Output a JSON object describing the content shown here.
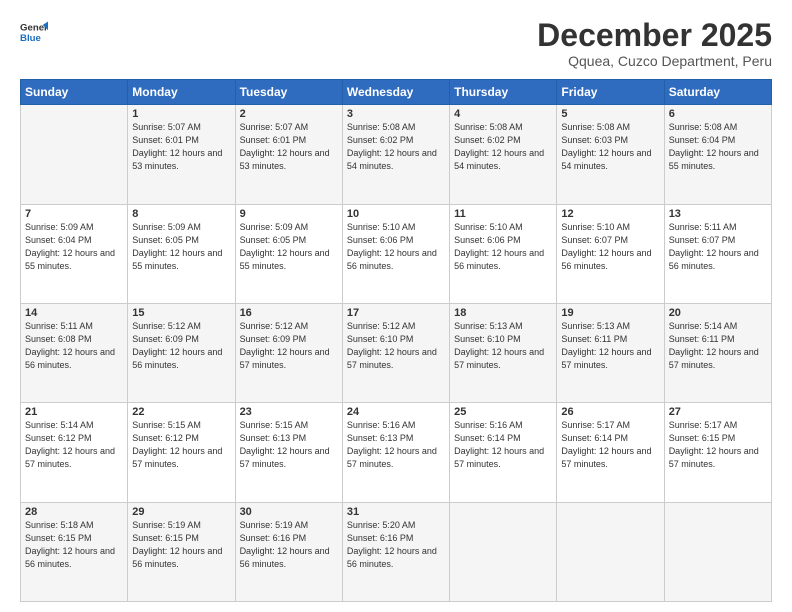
{
  "header": {
    "logo_line1": "General",
    "logo_line2": "Blue",
    "month": "December 2025",
    "location": "Qquea, Cuzco Department, Peru"
  },
  "weekdays": [
    "Sunday",
    "Monday",
    "Tuesday",
    "Wednesday",
    "Thursday",
    "Friday",
    "Saturday"
  ],
  "rows": [
    [
      {
        "day": "",
        "sunrise": "",
        "sunset": "",
        "daylight": ""
      },
      {
        "day": "1",
        "sunrise": "Sunrise: 5:07 AM",
        "sunset": "Sunset: 6:01 PM",
        "daylight": "Daylight: 12 hours and 53 minutes."
      },
      {
        "day": "2",
        "sunrise": "Sunrise: 5:07 AM",
        "sunset": "Sunset: 6:01 PM",
        "daylight": "Daylight: 12 hours and 53 minutes."
      },
      {
        "day": "3",
        "sunrise": "Sunrise: 5:08 AM",
        "sunset": "Sunset: 6:02 PM",
        "daylight": "Daylight: 12 hours and 54 minutes."
      },
      {
        "day": "4",
        "sunrise": "Sunrise: 5:08 AM",
        "sunset": "Sunset: 6:02 PM",
        "daylight": "Daylight: 12 hours and 54 minutes."
      },
      {
        "day": "5",
        "sunrise": "Sunrise: 5:08 AM",
        "sunset": "Sunset: 6:03 PM",
        "daylight": "Daylight: 12 hours and 54 minutes."
      },
      {
        "day": "6",
        "sunrise": "Sunrise: 5:08 AM",
        "sunset": "Sunset: 6:04 PM",
        "daylight": "Daylight: 12 hours and 55 minutes."
      }
    ],
    [
      {
        "day": "7",
        "sunrise": "Sunrise: 5:09 AM",
        "sunset": "Sunset: 6:04 PM",
        "daylight": "Daylight: 12 hours and 55 minutes."
      },
      {
        "day": "8",
        "sunrise": "Sunrise: 5:09 AM",
        "sunset": "Sunset: 6:05 PM",
        "daylight": "Daylight: 12 hours and 55 minutes."
      },
      {
        "day": "9",
        "sunrise": "Sunrise: 5:09 AM",
        "sunset": "Sunset: 6:05 PM",
        "daylight": "Daylight: 12 hours and 55 minutes."
      },
      {
        "day": "10",
        "sunrise": "Sunrise: 5:10 AM",
        "sunset": "Sunset: 6:06 PM",
        "daylight": "Daylight: 12 hours and 56 minutes."
      },
      {
        "day": "11",
        "sunrise": "Sunrise: 5:10 AM",
        "sunset": "Sunset: 6:06 PM",
        "daylight": "Daylight: 12 hours and 56 minutes."
      },
      {
        "day": "12",
        "sunrise": "Sunrise: 5:10 AM",
        "sunset": "Sunset: 6:07 PM",
        "daylight": "Daylight: 12 hours and 56 minutes."
      },
      {
        "day": "13",
        "sunrise": "Sunrise: 5:11 AM",
        "sunset": "Sunset: 6:07 PM",
        "daylight": "Daylight: 12 hours and 56 minutes."
      }
    ],
    [
      {
        "day": "14",
        "sunrise": "Sunrise: 5:11 AM",
        "sunset": "Sunset: 6:08 PM",
        "daylight": "Daylight: 12 hours and 56 minutes."
      },
      {
        "day": "15",
        "sunrise": "Sunrise: 5:12 AM",
        "sunset": "Sunset: 6:09 PM",
        "daylight": "Daylight: 12 hours and 56 minutes."
      },
      {
        "day": "16",
        "sunrise": "Sunrise: 5:12 AM",
        "sunset": "Sunset: 6:09 PM",
        "daylight": "Daylight: 12 hours and 57 minutes."
      },
      {
        "day": "17",
        "sunrise": "Sunrise: 5:12 AM",
        "sunset": "Sunset: 6:10 PM",
        "daylight": "Daylight: 12 hours and 57 minutes."
      },
      {
        "day": "18",
        "sunrise": "Sunrise: 5:13 AM",
        "sunset": "Sunset: 6:10 PM",
        "daylight": "Daylight: 12 hours and 57 minutes."
      },
      {
        "day": "19",
        "sunrise": "Sunrise: 5:13 AM",
        "sunset": "Sunset: 6:11 PM",
        "daylight": "Daylight: 12 hours and 57 minutes."
      },
      {
        "day": "20",
        "sunrise": "Sunrise: 5:14 AM",
        "sunset": "Sunset: 6:11 PM",
        "daylight": "Daylight: 12 hours and 57 minutes."
      }
    ],
    [
      {
        "day": "21",
        "sunrise": "Sunrise: 5:14 AM",
        "sunset": "Sunset: 6:12 PM",
        "daylight": "Daylight: 12 hours and 57 minutes."
      },
      {
        "day": "22",
        "sunrise": "Sunrise: 5:15 AM",
        "sunset": "Sunset: 6:12 PM",
        "daylight": "Daylight: 12 hours and 57 minutes."
      },
      {
        "day": "23",
        "sunrise": "Sunrise: 5:15 AM",
        "sunset": "Sunset: 6:13 PM",
        "daylight": "Daylight: 12 hours and 57 minutes."
      },
      {
        "day": "24",
        "sunrise": "Sunrise: 5:16 AM",
        "sunset": "Sunset: 6:13 PM",
        "daylight": "Daylight: 12 hours and 57 minutes."
      },
      {
        "day": "25",
        "sunrise": "Sunrise: 5:16 AM",
        "sunset": "Sunset: 6:14 PM",
        "daylight": "Daylight: 12 hours and 57 minutes."
      },
      {
        "day": "26",
        "sunrise": "Sunrise: 5:17 AM",
        "sunset": "Sunset: 6:14 PM",
        "daylight": "Daylight: 12 hours and 57 minutes."
      },
      {
        "day": "27",
        "sunrise": "Sunrise: 5:17 AM",
        "sunset": "Sunset: 6:15 PM",
        "daylight": "Daylight: 12 hours and 57 minutes."
      }
    ],
    [
      {
        "day": "28",
        "sunrise": "Sunrise: 5:18 AM",
        "sunset": "Sunset: 6:15 PM",
        "daylight": "Daylight: 12 hours and 56 minutes."
      },
      {
        "day": "29",
        "sunrise": "Sunrise: 5:19 AM",
        "sunset": "Sunset: 6:15 PM",
        "daylight": "Daylight: 12 hours and 56 minutes."
      },
      {
        "day": "30",
        "sunrise": "Sunrise: 5:19 AM",
        "sunset": "Sunset: 6:16 PM",
        "daylight": "Daylight: 12 hours and 56 minutes."
      },
      {
        "day": "31",
        "sunrise": "Sunrise: 5:20 AM",
        "sunset": "Sunset: 6:16 PM",
        "daylight": "Daylight: 12 hours and 56 minutes."
      },
      {
        "day": "",
        "sunrise": "",
        "sunset": "",
        "daylight": ""
      },
      {
        "day": "",
        "sunrise": "",
        "sunset": "",
        "daylight": ""
      },
      {
        "day": "",
        "sunrise": "",
        "sunset": "",
        "daylight": ""
      }
    ]
  ]
}
